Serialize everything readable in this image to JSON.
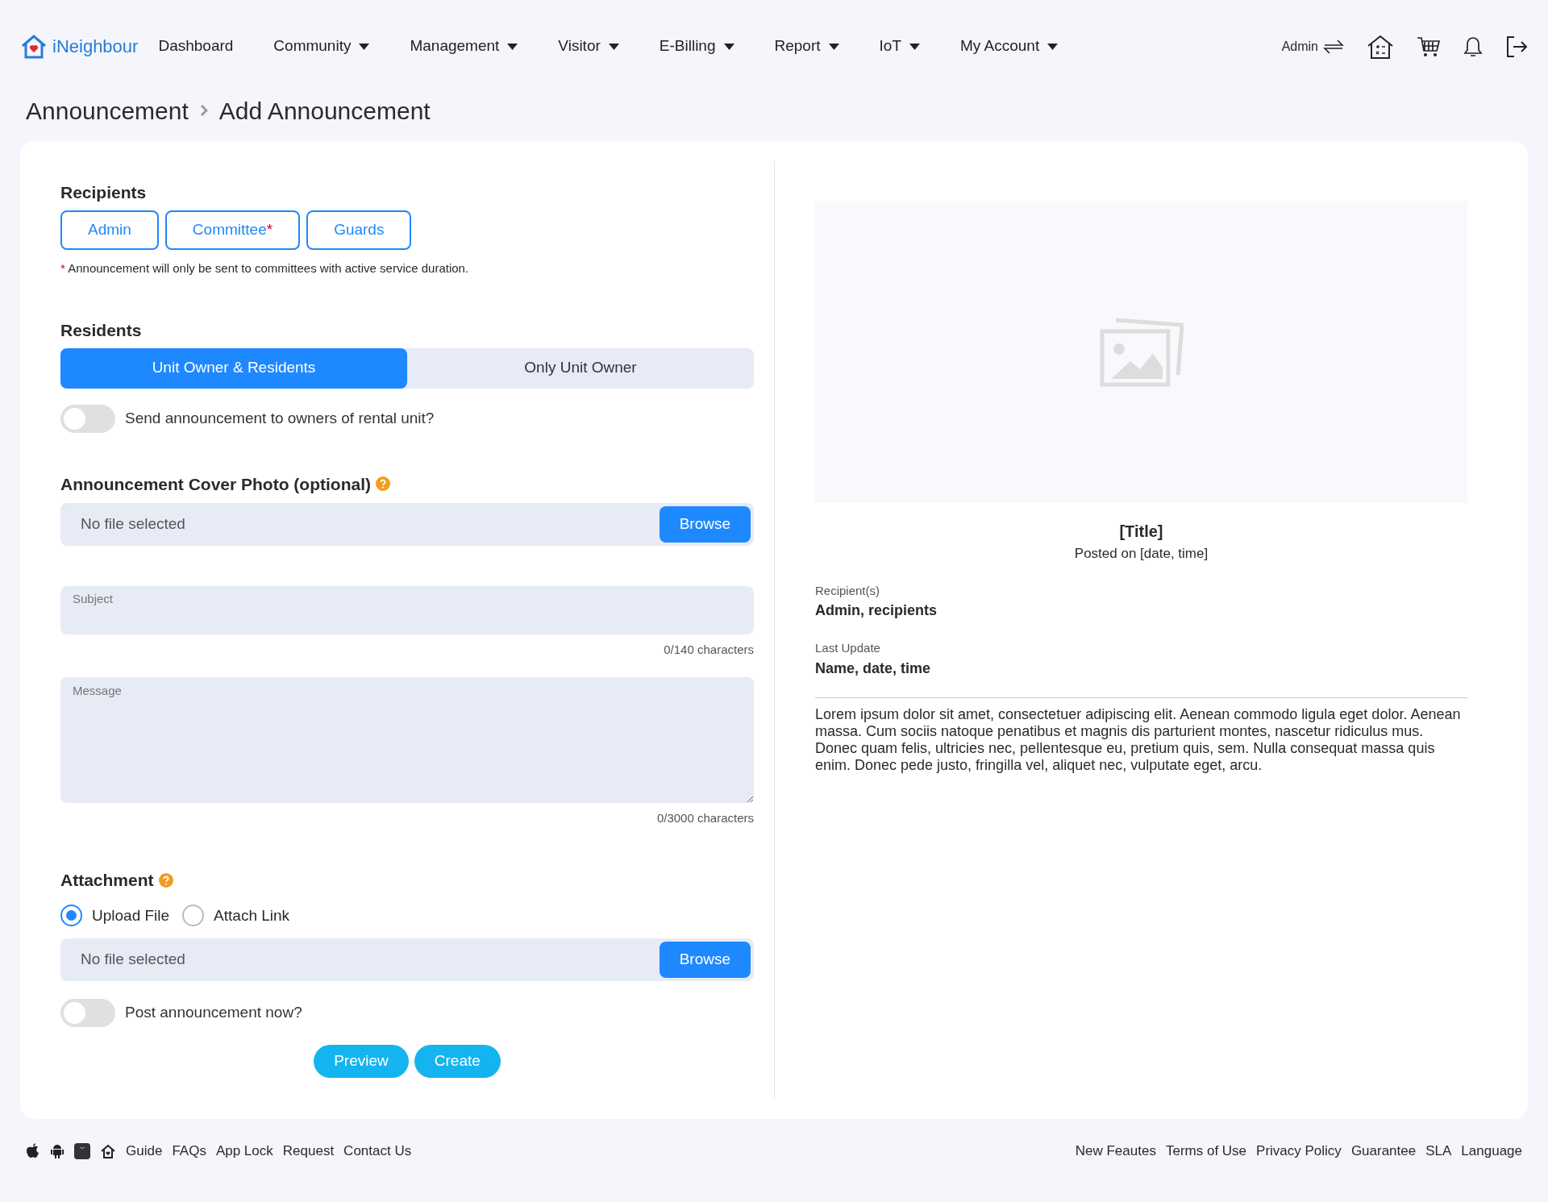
{
  "brand": "iNeighbour",
  "nav": [
    {
      "label": "Dashboard",
      "dropdown": false
    },
    {
      "label": "Community",
      "dropdown": true
    },
    {
      "label": "Management",
      "dropdown": true
    },
    {
      "label": "Visitor",
      "dropdown": true
    },
    {
      "label": "E-Billing",
      "dropdown": true
    },
    {
      "label": "Report",
      "dropdown": true
    },
    {
      "label": "IoT",
      "dropdown": true
    },
    {
      "label": "My Account",
      "dropdown": true
    }
  ],
  "user": "Admin",
  "breadcrumb": [
    "Announcement",
    "Add Announcement"
  ],
  "recipients": {
    "heading": "Recipients",
    "options": [
      {
        "label": "Admin",
        "selected": false
      },
      {
        "label": "Committee",
        "selected": false,
        "mark": "*"
      },
      {
        "label": "Guards",
        "selected": false
      }
    ],
    "note_mark": "*",
    "note": "Announcement will only be sent to committees with active service duration."
  },
  "residents": {
    "heading": "Residents",
    "options": [
      {
        "label": "Unit Owner & Residents",
        "selected": true
      },
      {
        "label": "Only Unit Owner",
        "selected": false
      }
    ],
    "toggle": {
      "label": "Send announcement to owners of rental unit?",
      "on": false
    }
  },
  "cover_photo": {
    "heading": "Announcement Cover Photo (optional)",
    "file": "No file selected",
    "button": "Browse"
  },
  "subject": {
    "placeholder": "Subject",
    "counter": "0/140 characters"
  },
  "message": {
    "placeholder": "Message",
    "counter": "0/3000 characters"
  },
  "attachment": {
    "heading": "Attachment",
    "options": [
      {
        "label": "Upload File",
        "selected": true
      },
      {
        "label": "Attach Link",
        "selected": false
      }
    ],
    "file": "No file selected",
    "button": "Browse"
  },
  "post_now": {
    "label": "Post announcement now?",
    "on": false
  },
  "actions": [
    "Preview",
    "Create"
  ],
  "preview": {
    "title": "[Title]",
    "posted": "Posted on [date, time]",
    "fields": [
      {
        "label": "Recipient(s)",
        "value": "Admin, recipients"
      },
      {
        "label": "Last Update",
        "value": "Name, date, time"
      }
    ],
    "body": "Lorem ipsum dolor sit amet, consectetuer adipiscing elit. Aenean commodo ligula eget dolor. Aenean massa. Cum sociis natoque penatibus et magnis dis parturient montes, nascetur ridiculus mus. Donec quam felis, ultricies nec, pellentesque eu, pretium quis, sem. Nulla consequat massa quis enim. Donec pede justo, fringilla vel, aliquet nec, vulputate eget, arcu."
  },
  "footer_left": [
    "Guide",
    "FAQs",
    "App Lock",
    "Request",
    "Contact Us"
  ],
  "footer_right": [
    "New Feautes",
    "Terms of Use",
    "Privacy Policy",
    "Guarantee",
    "SLA",
    "Language"
  ]
}
